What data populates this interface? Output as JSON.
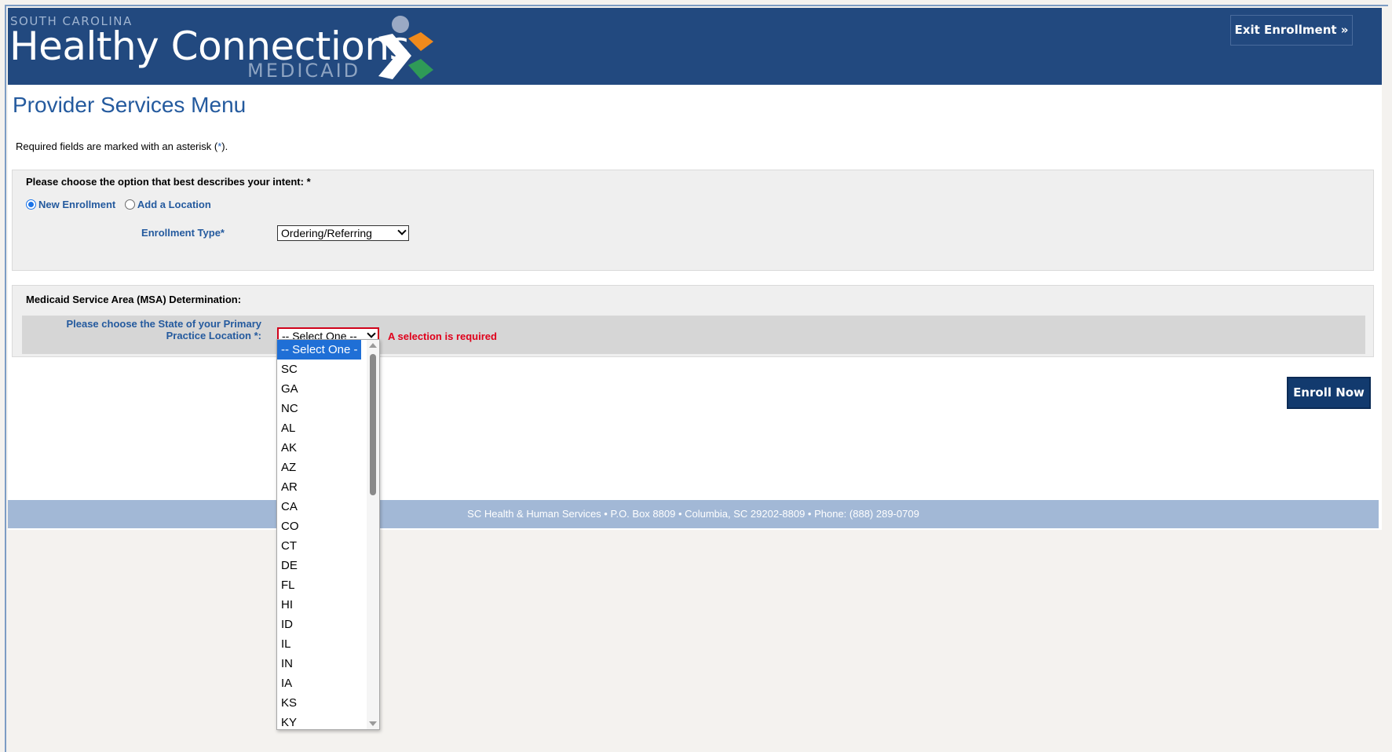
{
  "header": {
    "logo_top": "SOUTH CAROLINA",
    "logo_main": "Healthy Connections",
    "logo_sub": "MEDICAID",
    "exit_button": "Exit Enrollment »"
  },
  "page_title": "Provider Services Menu",
  "required_note": {
    "prefix": "Required fields are marked with an asterisk (",
    "asterisk": "*",
    "suffix": ")."
  },
  "intent": {
    "heading": "Please choose the option that best describes your intent: *",
    "options": [
      {
        "label": "New Enrollment",
        "selected": true
      },
      {
        "label": "Add a Location",
        "selected": false
      }
    ],
    "enrollment_type_label": "Enrollment Type*",
    "enrollment_type_value": "Ordering/Referring"
  },
  "msa": {
    "heading": "Medicaid Service Area (MSA) Determination:",
    "state_label_line1": "Please choose the State of your Primary",
    "state_label_line2": "Practice Location *:",
    "state_value": "-- Select One --",
    "error": "A selection is required",
    "options": [
      "-- Select One --",
      "SC",
      "GA",
      "NC",
      "AL",
      "AK",
      "AZ",
      "AR",
      "CA",
      "CO",
      "CT",
      "DE",
      "FL",
      "HI",
      "ID",
      "IL",
      "IN",
      "IA",
      "KS",
      "KY"
    ],
    "highlighted_index": 0
  },
  "enroll_button": "Enroll Now",
  "footer": "SC Health & Human Services • P.O. Box 8809 • Columbia, SC 29202-8809 • Phone: (888) 289-0709",
  "colors": {
    "header_bg": "#22497f",
    "accent_blue": "#245a9e",
    "error_red": "#e0001b",
    "footer_bg": "#a2b8d6",
    "logo_orange": "#f08a1c",
    "logo_green": "#2f9a57"
  }
}
